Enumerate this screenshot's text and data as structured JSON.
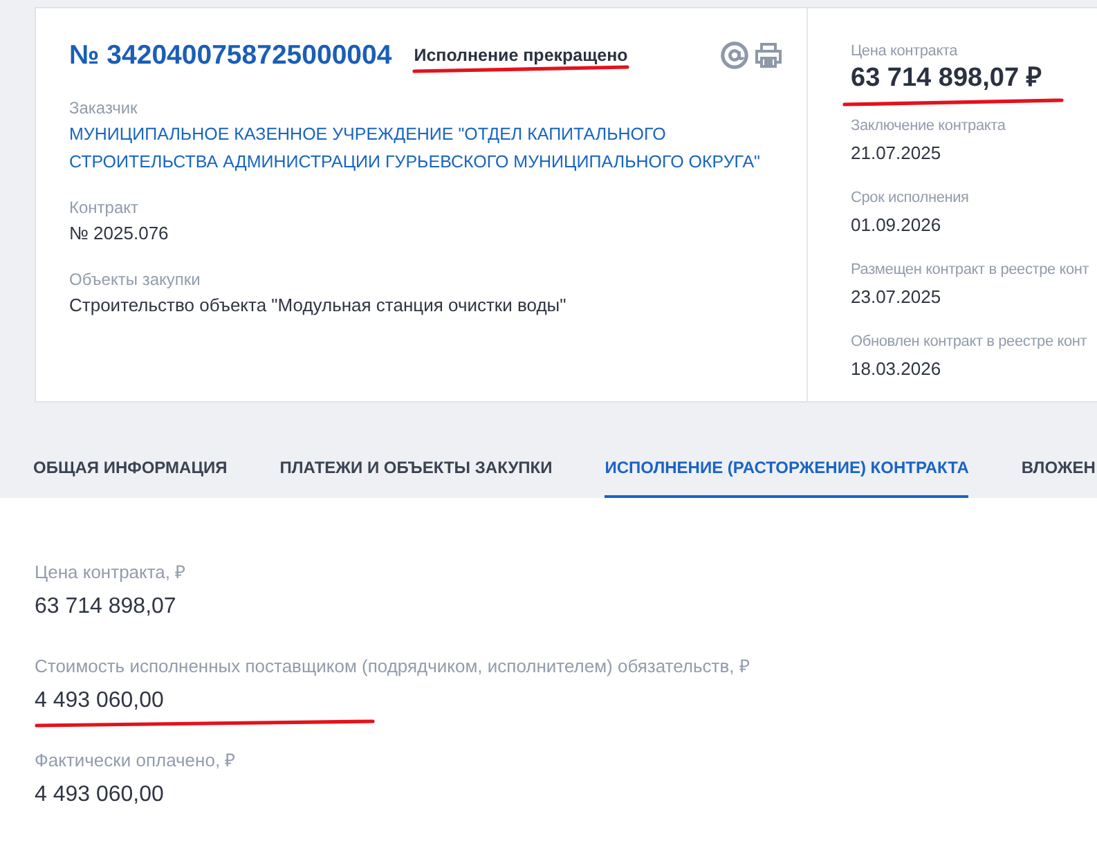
{
  "contract": {
    "number": "№ 3420400758725000004",
    "status": {
      "text": "Исполнение прекращено",
      "marked": true
    },
    "fields": [
      {
        "label": "Заказчик",
        "value": "МУНИЦИПАЛЬНОЕ КАЗЕННОЕ УЧРЕЖДЕНИЕ \"ОТДЕЛ КАПИТАЛЬНОГО СТРОИТЕЛЬСТВА АДМИНИСТРАЦИИ ГУРЬЕВСКОГО МУНИЦИПАЛЬНОГО ОКРУГА\"",
        "kind": "link"
      },
      {
        "label": "Контракт",
        "value": "№ 2025.076",
        "kind": "text"
      },
      {
        "label": "Объекты закупки",
        "value": "Строительство объекта \"Модульная станция очистки воды\"",
        "kind": "text"
      }
    ]
  },
  "summary": [
    {
      "label": "Цена контракта",
      "value": "63 714 898,07 ₽",
      "kind": "price",
      "marked": true
    },
    {
      "label": "Заключение контракта",
      "value": "21.07.2025",
      "kind": "date",
      "marked": false
    },
    {
      "label": "Срок исполнения",
      "value": "01.09.2026",
      "kind": "date",
      "marked": false
    },
    {
      "label": "Размещен контракт в реестре конт",
      "value": "23.07.2025",
      "kind": "date",
      "marked": false
    },
    {
      "label": "Обновлен контракт в реестре конт",
      "value": "18.03.2026",
      "kind": "date",
      "marked": false
    }
  ],
  "tabs": [
    {
      "label": "ОБЩАЯ ИНФОРМАЦИЯ",
      "selected": false
    },
    {
      "label": "ПЛАТЕЖИ И ОБЪЕКТЫ ЗАКУПКИ",
      "selected": false
    },
    {
      "label": "ИСПОЛНЕНИЕ (РАСТОРЖЕНИЕ) КОНТРАКТА",
      "selected": true
    },
    {
      "label": "ВЛОЖЕН",
      "selected": false
    }
  ],
  "execution": [
    {
      "label": "Цена контракта, ₽",
      "value": "63 714 898,07",
      "marked": false
    },
    {
      "label": "Стоимость исполненных поставщиком (подрядчиком, исполнителем) обязательств, ₽",
      "value": "4 493 060,00",
      "marked": true
    },
    {
      "label": "Фактически оплачено, ₽",
      "value": "4 493 060,00",
      "marked": false
    }
  ]
}
